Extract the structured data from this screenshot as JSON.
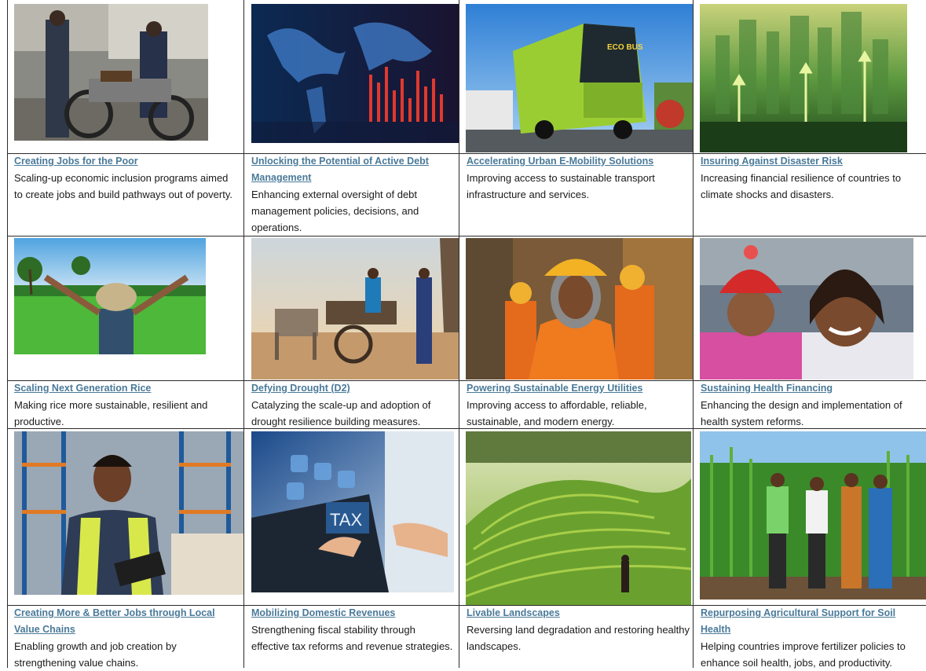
{
  "colors": {
    "link": "#4a7a99",
    "text": "#1a1a1a",
    "border": "#2b2b2b"
  },
  "cards": [
    {
      "title": "Creating Jobs for the Poor",
      "desc": "Scaling-up economic inclusion programs aimed to create jobs and build pathways out of poverty.",
      "image": "motorcycle-workshop-photo"
    },
    {
      "title": "Unlocking the Potential of Active Debt Management",
      "desc": "Enhancing external oversight of debt management policies, decisions, and operations.",
      "image": "data-world-map-photo"
    },
    {
      "title": "Accelerating Urban E-Mobility Solutions",
      "desc": "Improving access to sustainable transport infrastructure and services.",
      "image": "electric-bus-photo",
      "bus_sign": "ECO BUS"
    },
    {
      "title": "Insuring Against Disaster Risk",
      "desc": "Increasing financial resilience of countries to climate shocks and disasters.",
      "image": "green-city-arrows-photo"
    },
    {
      "title": "Scaling Next Generation Rice",
      "desc": "Making rice more sustainable, resilient and productive.",
      "image": "rice-field-farmer-photo"
    },
    {
      "title": "Defying Drought (D2)",
      "desc": "Catalyzing the scale-up and adoption of drought resilience building measures.",
      "image": "donkey-cart-photo"
    },
    {
      "title": "Powering Sustainable Energy Utilities",
      "desc": "Improving access to affordable, reliable, sustainable, and modern energy.",
      "image": "energy-workers-photo"
    },
    {
      "title": "Sustaining Health Financing",
      "desc": "Enhancing the design and implementation of health system reforms.",
      "image": "mother-child-photo"
    },
    {
      "title": "Creating More & Better Jobs through Local Value Chains",
      "desc": "Enabling growth and job creation by strengthening value chains.",
      "image": "warehouse-worker-photo"
    },
    {
      "title": "Mobilizing Domestic Revenues",
      "desc": "Strengthening fiscal stability through effective tax reforms and revenue strategies.",
      "image": "tax-laptop-photo",
      "overlay_text": "TAX"
    },
    {
      "title": "Livable Landscapes",
      "desc": "Reversing land degradation and restoring healthy landscapes.",
      "image": "terraced-hills-photo"
    },
    {
      "title": "Repurposing Agricultural Support for Soil Health",
      "desc": "Helping countries improve fertilizer policies to enhance soil health, jobs, and productivity.",
      "image": "maize-farmers-photo"
    }
  ]
}
